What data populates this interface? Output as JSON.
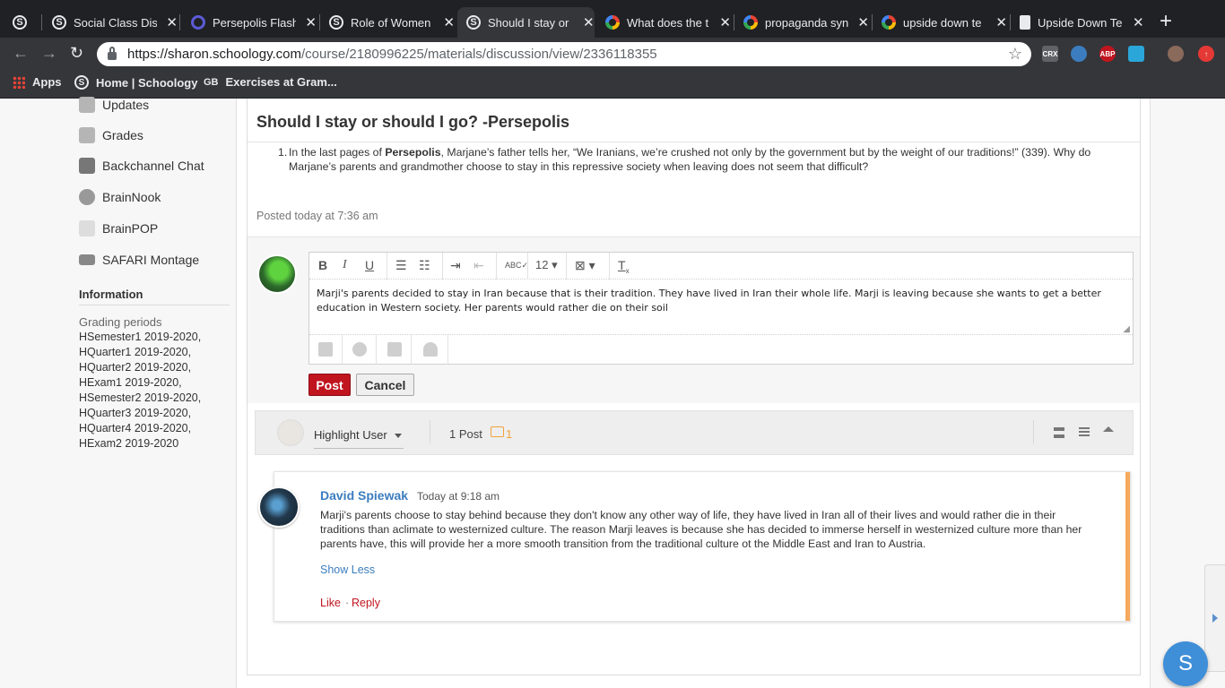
{
  "browser": {
    "tabs": [
      {
        "title": "",
        "icon": "schoology-icon"
      },
      {
        "title": "Social Class Dis",
        "icon": "schoology-icon"
      },
      {
        "title": "Persepolis Flash",
        "icon": "quizlet-icon"
      },
      {
        "title": "Role of Women",
        "icon": "schoology-icon"
      },
      {
        "title": "Should I stay or",
        "icon": "schoology-icon"
      },
      {
        "title": "What does the t",
        "icon": "google-icon"
      },
      {
        "title": "propaganda syn",
        "icon": "google-icon"
      },
      {
        "title": "upside down te",
        "icon": "google-icon"
      },
      {
        "title": "Upside Down Te",
        "icon": "document-icon"
      }
    ],
    "new_tab": "+",
    "url_host": "https://sharon.schoology.com",
    "url_path": "/course/2180996225/materials/discussion/view/2336118355",
    "bookmarks": [
      {
        "label": "Apps"
      },
      {
        "label": "Home | Schoology"
      },
      {
        "label": "Exercises at Gram..."
      }
    ],
    "extensions": [
      "CRX",
      "ABP"
    ]
  },
  "sidebar": {
    "nav": [
      "Updates",
      "Grades",
      "Backchannel Chat",
      "BrainNook",
      "BrainPOP",
      "SAFARI Montage"
    ],
    "info_heading": "Information",
    "grading_label": "Grading periods",
    "grading_periods": [
      "HSemester1 2019-2020,",
      "HQuarter1 2019-2020,",
      "HQuarter2 2019-2020,",
      "HExam1 2019-2020,",
      "HSemester2 2019-2020,",
      "HQuarter3 2019-2020,",
      "HQuarter4 2019-2020,",
      "HExam2 2019-2020"
    ]
  },
  "discussion": {
    "title": "Should I stay or should I go? -Persepolis",
    "prompt_number": "1.",
    "prompt_before": "In the last pages of ",
    "prompt_bold": "Persepolis",
    "prompt_after": ", Marjane’s father tells her, “We Iranians, we’re crushed not only by the government but by the weight of our traditions!” (339). Why do Marjane’s parents and grandmother choose to stay in this repressive society when leaving does not seem that difficult?",
    "posted": "Posted today at 7:36 am"
  },
  "editor": {
    "font_size": "12",
    "draft_text": "Marji's parents decided to stay in Iran because that is their tradition. They have lived in Iran their whole life. Marji is leaving because she wants to get a better education in Western society. Her parents would rather die on their soil",
    "post_label": "Post",
    "cancel_label": "Cancel"
  },
  "filter": {
    "highlight_label": "Highlight User",
    "post_count": "1 Post",
    "comment_count": "1"
  },
  "post": {
    "author": "David Spiewak",
    "time": "Today at 9:18 am",
    "body": "Marji's parents choose to stay behind because they don't know any other way of life, they have lived in Iran all of their lives and would rather die in their traditions than aclimate to westernized culture. The reason Marji leaves is because she has decided to immerse herself in westernized culture more than her parents have, this will provide her a more smooth transition from the traditional culture ot the Middle East and Iran to Austria.",
    "show_less": "Show Less",
    "like": "Like",
    "reply": "Reply",
    "separator": "·"
  },
  "chat_fab": "S",
  "colors": {
    "post_button": "#c0151f",
    "link": "#3b7dbf",
    "accent": "#f6a95d"
  }
}
